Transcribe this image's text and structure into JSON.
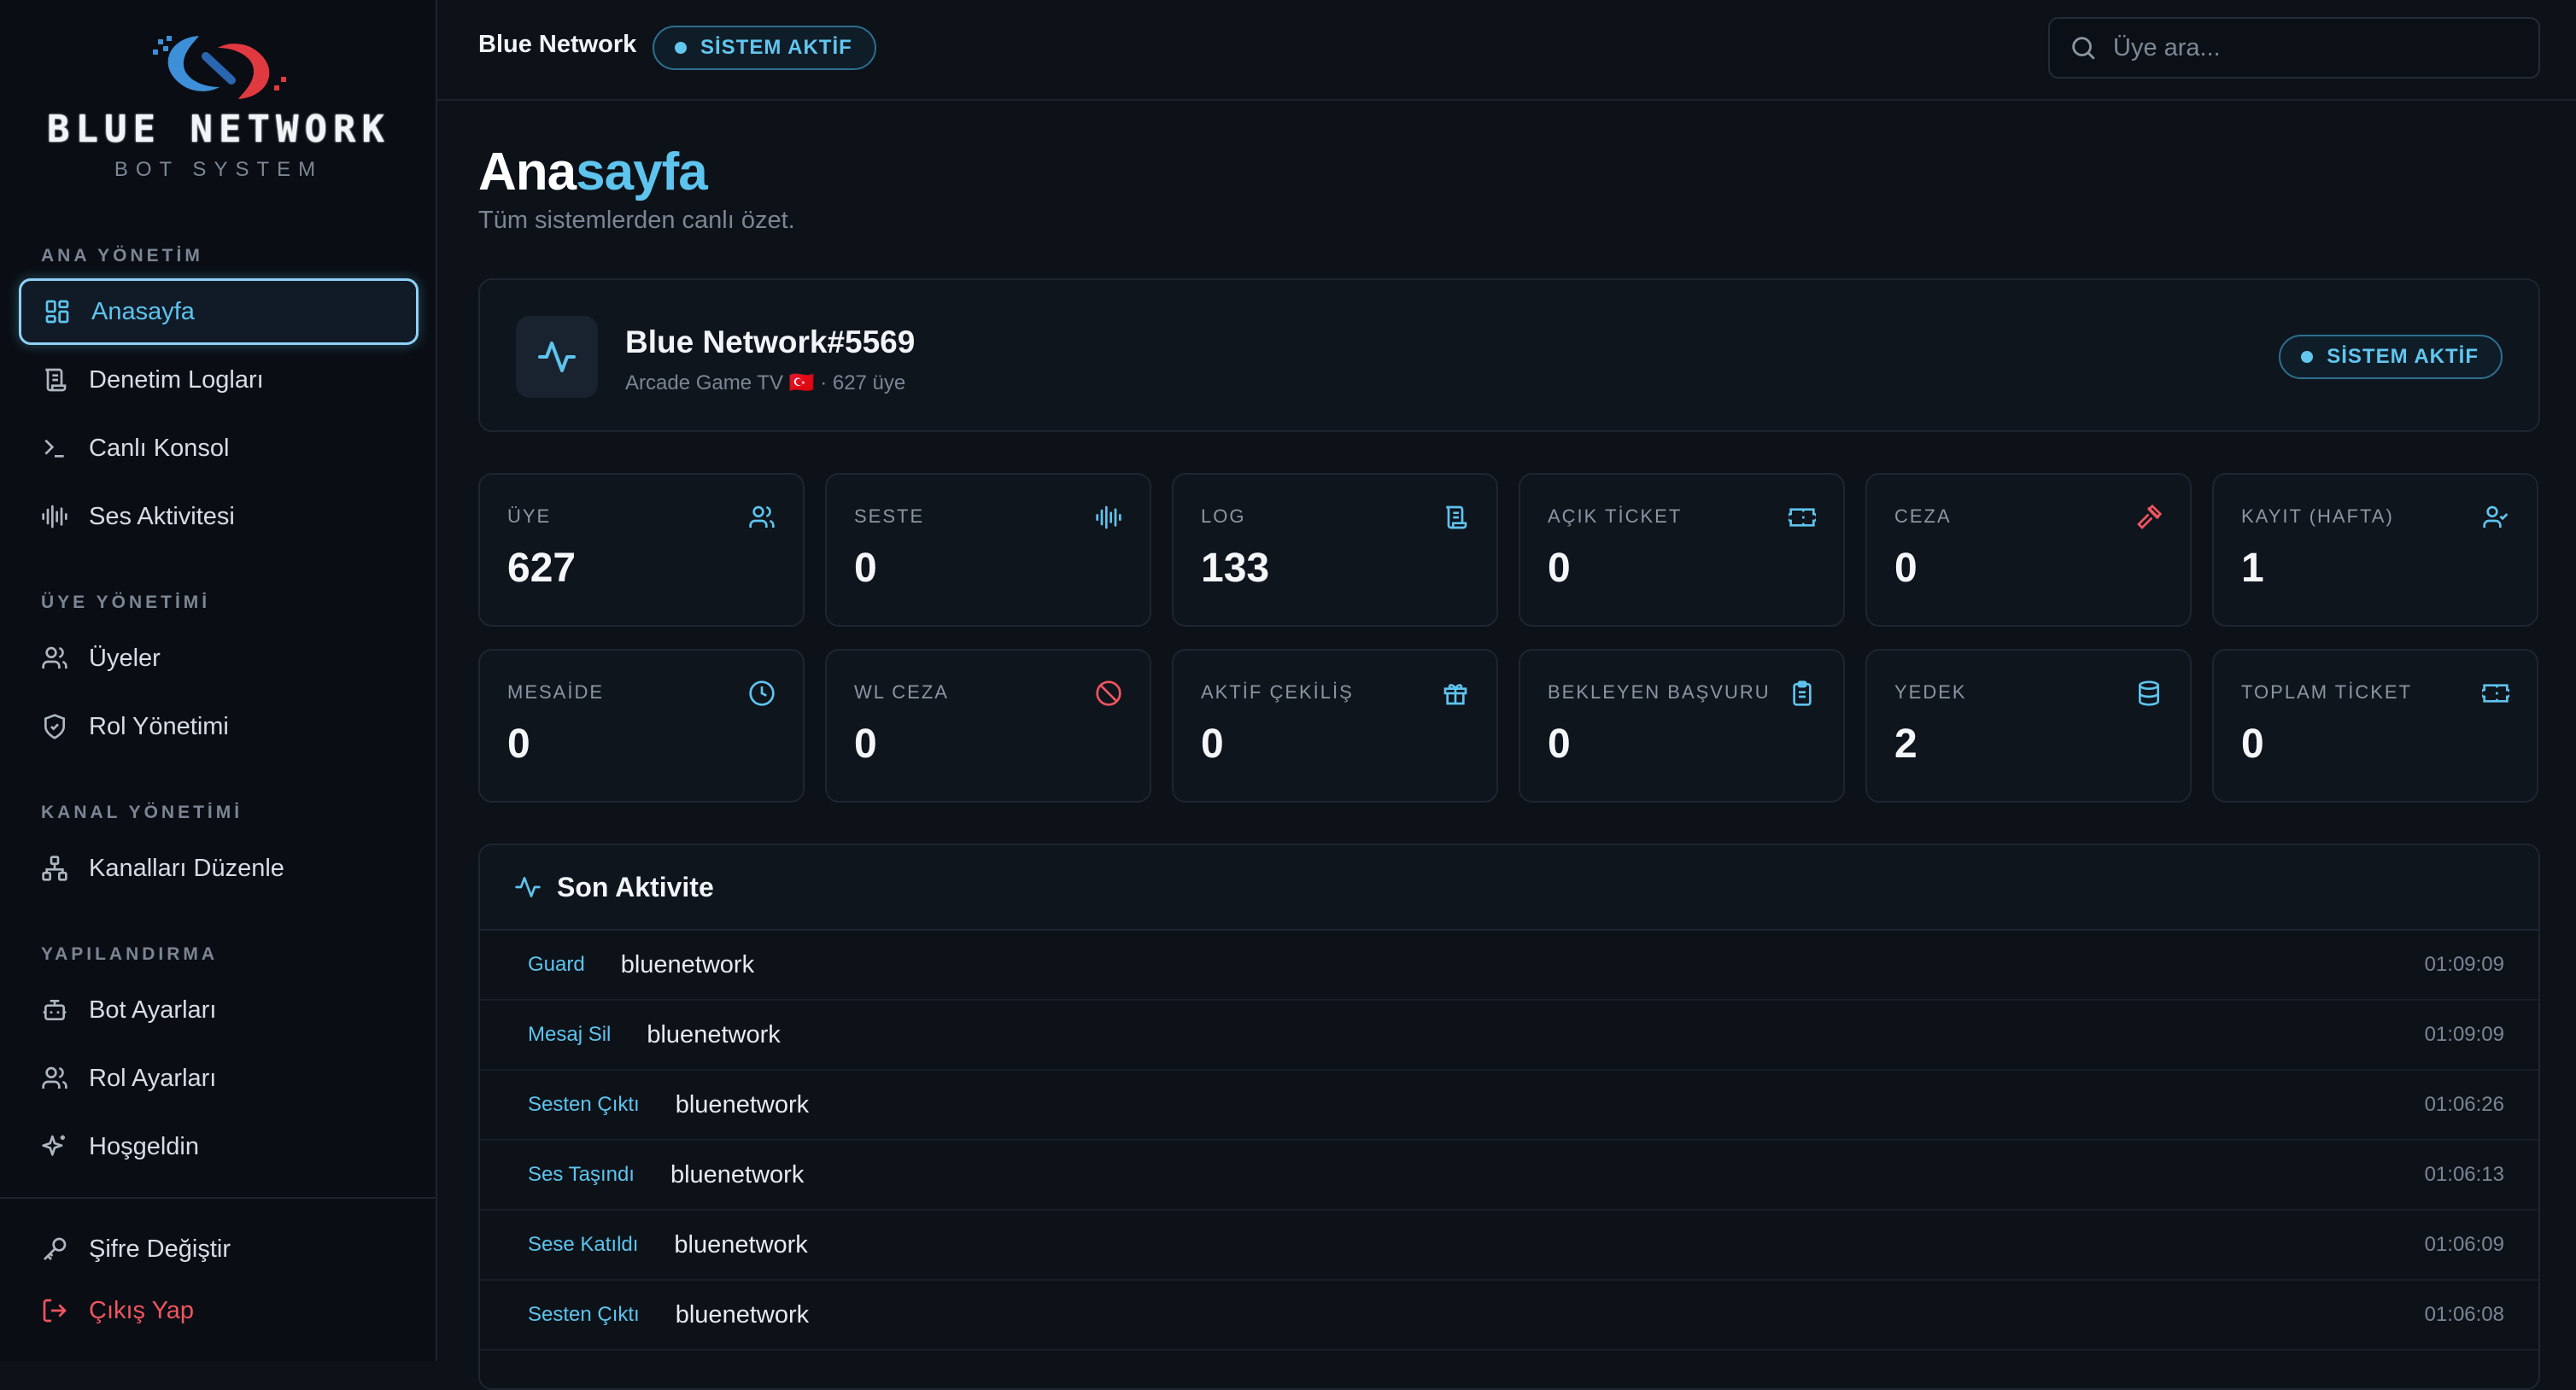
{
  "brand": {
    "name": "BLUE NETWORK",
    "subtitle": "BOT SYSTEM"
  },
  "sidebar": {
    "sections": [
      {
        "label": "ANA YÖNETİM",
        "items": [
          {
            "label": "Anasayfa",
            "icon": "dashboard-icon",
            "active": true
          },
          {
            "label": "Denetim Logları",
            "icon": "scroll-icon"
          },
          {
            "label": "Canlı Konsol",
            "icon": "terminal-icon"
          },
          {
            "label": "Ses Aktivitesi",
            "icon": "audio-wave-icon"
          }
        ]
      },
      {
        "label": "ÜYE YÖNETİMİ",
        "items": [
          {
            "label": "Üyeler",
            "icon": "users-icon"
          },
          {
            "label": "Rol Yönetimi",
            "icon": "shield-icon"
          }
        ]
      },
      {
        "label": "KANAL YÖNETİMİ",
        "items": [
          {
            "label": "Kanalları Düzenle",
            "icon": "network-icon"
          }
        ]
      },
      {
        "label": "YAPILANDIRMA",
        "items": [
          {
            "label": "Bot Ayarları",
            "icon": "bot-icon"
          },
          {
            "label": "Rol Ayarları",
            "icon": "users-icon"
          },
          {
            "label": "Hoşgeldin",
            "icon": "sparkles-icon"
          }
        ]
      }
    ],
    "footer": [
      {
        "label": "Şifre Değiştir",
        "icon": "key-icon"
      },
      {
        "label": "Çıkış Yap",
        "icon": "logout-icon"
      }
    ]
  },
  "topbar": {
    "title": "Blue Network",
    "status": "SİSTEM AKTİF",
    "search_placeholder": "Üye ara..."
  },
  "page": {
    "title_part1": "Ana",
    "title_part2": "sayfa",
    "subtitle": "Tüm sistemlerden canlı özet."
  },
  "server": {
    "name": "Blue Network#5569",
    "meta": "Arcade Game TV 🇹🇷 · 627 üye",
    "status": "SİSTEM AKTİF"
  },
  "stats": [
    {
      "label": "ÜYE",
      "value": "627",
      "icon": "users-icon",
      "color": "#5ec4ee"
    },
    {
      "label": "SESTE",
      "value": "0",
      "icon": "audio-wave-icon",
      "color": "#5ec4ee"
    },
    {
      "label": "LOG",
      "value": "133",
      "icon": "scroll-icon",
      "color": "#5ec4ee"
    },
    {
      "label": "AÇIK TİCKET",
      "value": "0",
      "icon": "ticket-icon",
      "color": "#5ec4ee"
    },
    {
      "label": "CEZA",
      "value": "0",
      "icon": "gavel-icon",
      "color": "#f0555e"
    },
    {
      "label": "KAYIT (HAFTA)",
      "value": "1",
      "icon": "user-check-icon",
      "color": "#5ec4ee"
    },
    {
      "label": "MESAİDE",
      "value": "0",
      "icon": "clock-icon",
      "color": "#5ec4ee"
    },
    {
      "label": "WL CEZA",
      "value": "0",
      "icon": "ban-icon",
      "color": "#f0555e"
    },
    {
      "label": "AKTİF ÇEKİLİŞ",
      "value": "0",
      "icon": "gift-icon",
      "color": "#5ec4ee"
    },
    {
      "label": "BEKLEYEN BAŞVURU",
      "value": "0",
      "icon": "clipboard-icon",
      "color": "#5ec4ee"
    },
    {
      "label": "YEDEK",
      "value": "2",
      "icon": "database-icon",
      "color": "#5ec4ee"
    },
    {
      "label": "TOPLAM TİCKET",
      "value": "0",
      "icon": "ticket-icon",
      "color": "#5ec4ee"
    }
  ],
  "activity": {
    "title": "Son Aktivite",
    "rows": [
      {
        "type": "Guard",
        "user": "bluenetwork",
        "time": "01:09:09"
      },
      {
        "type": "Mesaj Sil",
        "user": "bluenetwork",
        "time": "01:09:09"
      },
      {
        "type": "Sesten Çıktı",
        "user": "bluenetwork",
        "time": "01:06:26"
      },
      {
        "type": "Ses Taşındı",
        "user": "bluenetwork",
        "time": "01:06:13"
      },
      {
        "type": "Sese Katıldı",
        "user": "bluenetwork",
        "time": "01:06:09"
      },
      {
        "type": "Sesten Çıktı",
        "user": "bluenetwork",
        "time": "01:06:08"
      }
    ]
  },
  "colors": {
    "accent": "#5ec4ee",
    "danger": "#f0555e",
    "background": "#0d1219",
    "sidebar": "#0a0e14"
  }
}
